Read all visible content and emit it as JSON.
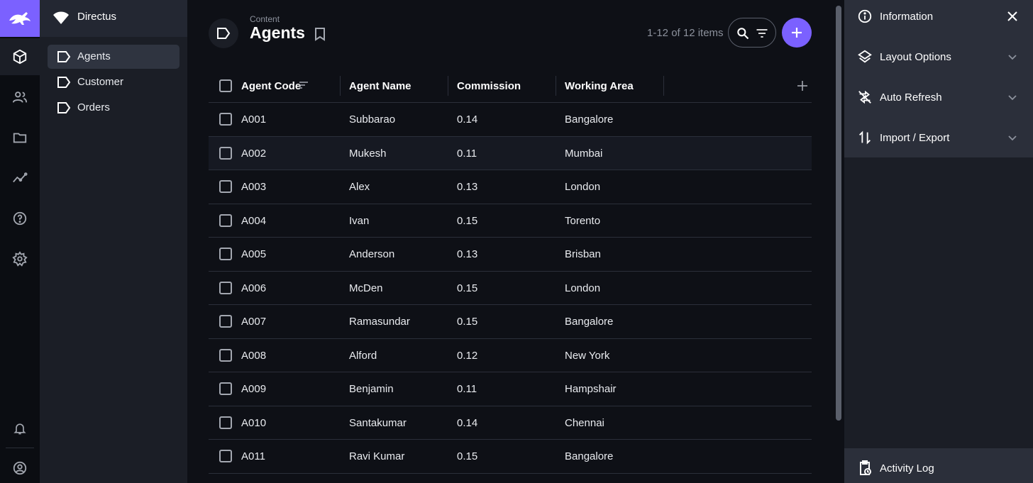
{
  "project": {
    "name": "Directus"
  },
  "nav": {
    "items": [
      {
        "label": "Agents",
        "active": true
      },
      {
        "label": "Customer",
        "active": false
      },
      {
        "label": "Orders",
        "active": false
      }
    ]
  },
  "header": {
    "breadcrumb": "Content",
    "title": "Agents",
    "count": "1-12 of 12 items"
  },
  "table": {
    "columns": [
      "Agent Code",
      "Agent Name",
      "Commission",
      "Working Area"
    ],
    "rows": [
      [
        "A001",
        "Subbarao",
        "0.14",
        "Bangalore"
      ],
      [
        "A002",
        "Mukesh",
        "0.11",
        "Mumbai"
      ],
      [
        "A003",
        "Alex",
        "0.13",
        "London"
      ],
      [
        "A004",
        "Ivan",
        "0.15",
        "Torento"
      ],
      [
        "A005",
        "Anderson",
        "0.13",
        "Brisban"
      ],
      [
        "A006",
        "McDen",
        "0.15",
        "London"
      ],
      [
        "A007",
        "Ramasundar",
        "0.15",
        "Bangalore"
      ],
      [
        "A008",
        "Alford",
        "0.12",
        "New York"
      ],
      [
        "A009",
        "Benjamin",
        "0.11",
        "Hampshair"
      ],
      [
        "A010",
        "Santakumar",
        "0.14",
        "Chennai"
      ],
      [
        "A011",
        "Ravi Kumar",
        "0.15",
        "Bangalore"
      ]
    ]
  },
  "sidebar": {
    "items": [
      {
        "label": "Information",
        "icon": "info-icon"
      },
      {
        "label": "Layout Options",
        "icon": "layers-icon"
      },
      {
        "label": "Auto Refresh",
        "icon": "refresh-icon"
      },
      {
        "label": "Import / Export",
        "icon": "import-export-icon"
      }
    ],
    "footer": {
      "label": "Activity Log",
      "icon": "activity-log-icon"
    }
  },
  "colors": {
    "accent": "#7b61ff",
    "background": "#0e1016",
    "nav_bg": "#1b1e26",
    "sidebar_panel": "#2b2f3a"
  }
}
